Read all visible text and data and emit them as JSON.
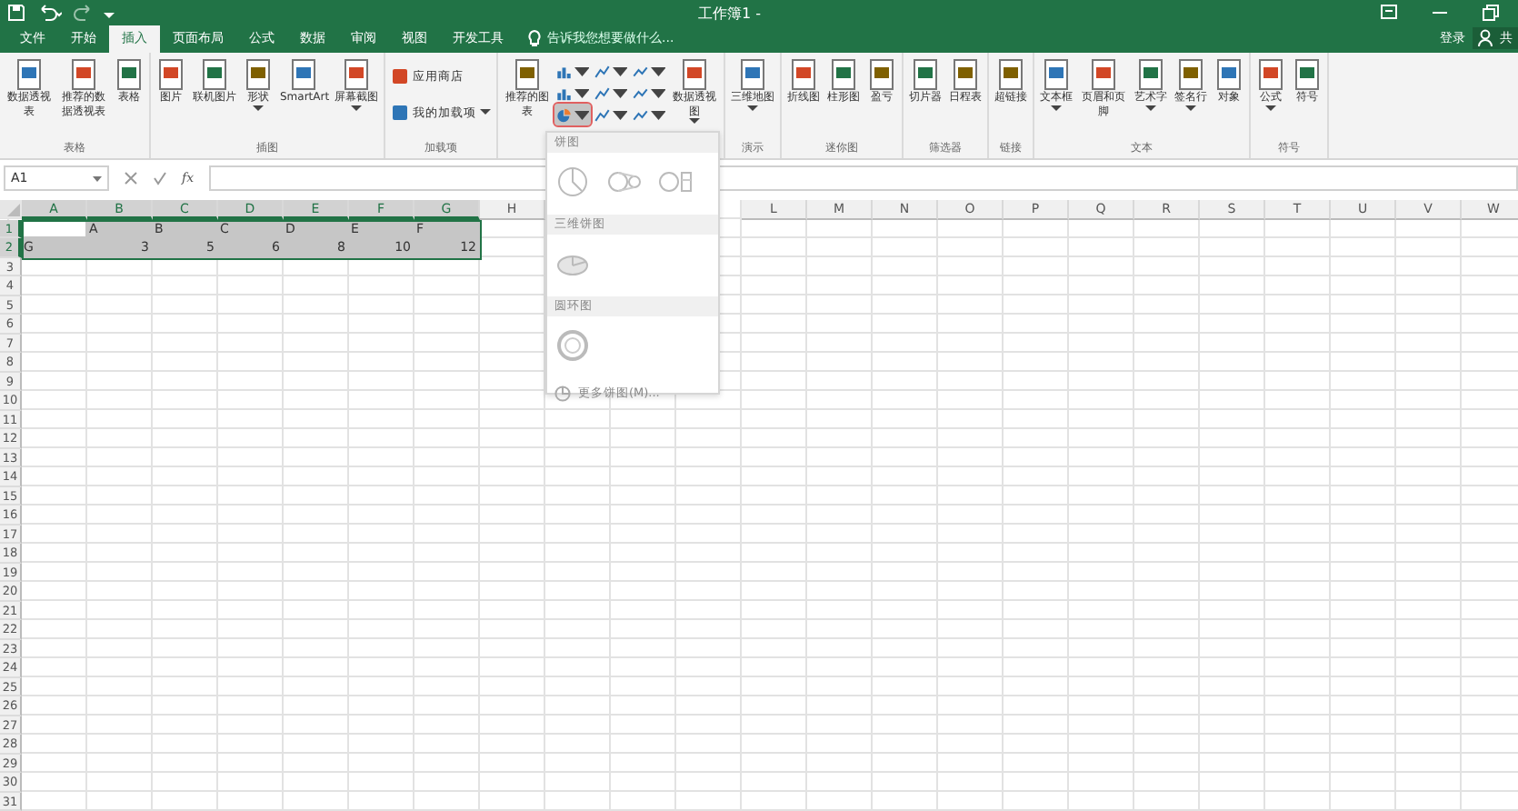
{
  "window": {
    "title": "工作簿1 -"
  },
  "account": {
    "sign_in": "登录",
    "share": "共"
  },
  "tabs": [
    {
      "label": "文件",
      "selected": false
    },
    {
      "label": "开始",
      "selected": false
    },
    {
      "label": "插入",
      "selected": true
    },
    {
      "label": "页面布局",
      "selected": false
    },
    {
      "label": "公式",
      "selected": false
    },
    {
      "label": "数据",
      "selected": false
    },
    {
      "label": "审阅",
      "selected": false
    },
    {
      "label": "视图",
      "selected": false
    },
    {
      "label": "开发工具",
      "selected": false
    }
  ],
  "tell_me": {
    "placeholder": "告诉我您想要做什么..."
  },
  "ribbon_groups": [
    {
      "label": "表格",
      "items": [
        {
          "kind": "large",
          "label": "数据透视表",
          "dropdown": false
        },
        {
          "kind": "large",
          "label": "推荐的数据透视表",
          "dropdown": false
        },
        {
          "kind": "large",
          "label": "表格",
          "dropdown": false
        }
      ]
    },
    {
      "label": "插图",
      "items": [
        {
          "kind": "large",
          "label": "图片",
          "dropdown": false
        },
        {
          "kind": "large",
          "label": "联机图片",
          "dropdown": false
        },
        {
          "kind": "large",
          "label": "形状",
          "dropdown": true
        },
        {
          "kind": "large",
          "label": "SmartArt",
          "dropdown": false
        },
        {
          "kind": "large",
          "label": "屏幕截图",
          "dropdown": true
        }
      ]
    },
    {
      "label": "加载项",
      "items": [
        {
          "kind": "small",
          "label": "应用商店",
          "dropdown": false
        },
        {
          "kind": "small",
          "label": "我的加载项",
          "dropdown": true
        }
      ]
    },
    {
      "items": [
        {
          "kind": "large",
          "label": "推荐的图表",
          "dropdown": false
        },
        {
          "kind": "gallery",
          "buttons": [
            {
              "pressed": false
            },
            {
              "pressed": false
            },
            {
              "pressed": false
            },
            {
              "pressed": false
            },
            {
              "pressed": false
            },
            {
              "pressed": false
            },
            {
              "pressed": true
            },
            {
              "pressed": false
            },
            {
              "pressed": false
            }
          ]
        },
        {
          "kind": "large",
          "label": "数据透视图",
          "dropdown": true
        }
      ]
    },
    {
      "label": "演示",
      "items": [
        {
          "kind": "large",
          "label": "三维地图",
          "dropdown": true
        }
      ]
    },
    {
      "label": "迷你图",
      "items": [
        {
          "kind": "large",
          "label": "折线图",
          "dropdown": false
        },
        {
          "kind": "large",
          "label": "柱形图",
          "dropdown": false
        },
        {
          "kind": "large",
          "label": "盈亏",
          "dropdown": false
        }
      ]
    },
    {
      "label": "筛选器",
      "items": [
        {
          "kind": "large",
          "label": "切片器",
          "dropdown": false
        },
        {
          "kind": "large",
          "label": "日程表",
          "dropdown": false
        }
      ]
    },
    {
      "label": "链接",
      "items": [
        {
          "kind": "large",
          "label": "超链接",
          "dropdown": false
        }
      ]
    },
    {
      "label": "文本",
      "items": [
        {
          "kind": "large",
          "label": "文本框",
          "dropdown": true
        },
        {
          "kind": "large",
          "label": "页眉和页脚",
          "dropdown": false
        },
        {
          "kind": "large",
          "label": "艺术字",
          "dropdown": true
        },
        {
          "kind": "large",
          "label": "签名行",
          "dropdown": true
        },
        {
          "kind": "large",
          "label": "对象",
          "dropdown": false
        }
      ]
    },
    {
      "label": "符号",
      "items": [
        {
          "kind": "large",
          "label": "公式",
          "dropdown": true
        },
        {
          "kind": "large",
          "label": "符号",
          "dropdown": false
        }
      ]
    }
  ],
  "formula_bar": {
    "name_box": "A1",
    "fx": "fx"
  },
  "pie_menu": {
    "sections": [
      {
        "header": "饼图",
        "kind": "pie2d"
      },
      {
        "header": "三维饼图",
        "kind": "pie3d"
      },
      {
        "header": "圆环图",
        "kind": "donut"
      }
    ],
    "footer": "更多饼图(M)..."
  },
  "sheet": {
    "columns_left": [
      {
        "label": "A",
        "selected": true
      },
      {
        "label": "B",
        "selected": true
      },
      {
        "label": "C",
        "selected": true
      },
      {
        "label": "D",
        "selected": true
      },
      {
        "label": "E",
        "selected": true
      },
      {
        "label": "F",
        "selected": true
      },
      {
        "label": "G",
        "selected": true
      },
      {
        "label": "H",
        "selected": false
      }
    ],
    "columns_right": [
      {
        "label": "L",
        "selected": false
      },
      {
        "label": "M",
        "selected": false
      },
      {
        "label": "N",
        "selected": false
      },
      {
        "label": "O",
        "selected": false
      },
      {
        "label": "P",
        "selected": false
      },
      {
        "label": "Q",
        "selected": false
      },
      {
        "label": "R",
        "selected": false
      },
      {
        "label": "S",
        "selected": false
      },
      {
        "label": "T",
        "selected": false
      },
      {
        "label": "U",
        "selected": false
      },
      {
        "label": "V",
        "selected": false
      },
      {
        "label": "W",
        "selected": false
      }
    ],
    "rows": [
      {
        "label": "1",
        "selected": true,
        "cells": [
          {
            "active": true
          },
          {
            "text": "A"
          },
          {
            "text": "B"
          },
          {
            "text": "C"
          },
          {
            "text": "D"
          },
          {
            "text": "E"
          },
          {
            "text": "F"
          }
        ]
      },
      {
        "label": "2",
        "selected": true,
        "cells": [
          {
            "text": "G"
          },
          {
            "text": "3",
            "kind": "number"
          },
          {
            "text": "5",
            "kind": "number"
          },
          {
            "text": "6",
            "kind": "number"
          },
          {
            "text": "8",
            "kind": "number"
          },
          {
            "text": "10",
            "kind": "number"
          },
          {
            "text": "12",
            "kind": "number"
          }
        ]
      },
      {
        "label": "3",
        "selected": false
      },
      {
        "label": "4",
        "selected": false
      },
      {
        "label": "5",
        "selected": false
      },
      {
        "label": "6",
        "selected": false
      },
      {
        "label": "7",
        "selected": false
      },
      {
        "label": "8",
        "selected": false
      },
      {
        "label": "9",
        "selected": false
      },
      {
        "label": "10",
        "selected": false
      },
      {
        "label": "11",
        "selected": false
      },
      {
        "label": "12",
        "selected": false
      },
      {
        "label": "13",
        "selected": false
      },
      {
        "label": "14",
        "selected": false
      },
      {
        "label": "15",
        "selected": false
      },
      {
        "label": "16",
        "selected": false
      },
      {
        "label": "17",
        "selected": false
      },
      {
        "label": "18",
        "selected": false
      },
      {
        "label": "19",
        "selected": false
      },
      {
        "label": "20",
        "selected": false
      },
      {
        "label": "21",
        "selected": false
      },
      {
        "label": "22",
        "selected": false
      },
      {
        "label": "23",
        "selected": false
      },
      {
        "label": "24",
        "selected": false
      },
      {
        "label": "25",
        "selected": false
      },
      {
        "label": "26",
        "selected": false
      },
      {
        "label": "27",
        "selected": false
      },
      {
        "label": "28",
        "selected": false
      },
      {
        "label": "29",
        "selected": false
      },
      {
        "label": "30",
        "selected": false
      },
      {
        "label": "31",
        "selected": false
      }
    ]
  }
}
